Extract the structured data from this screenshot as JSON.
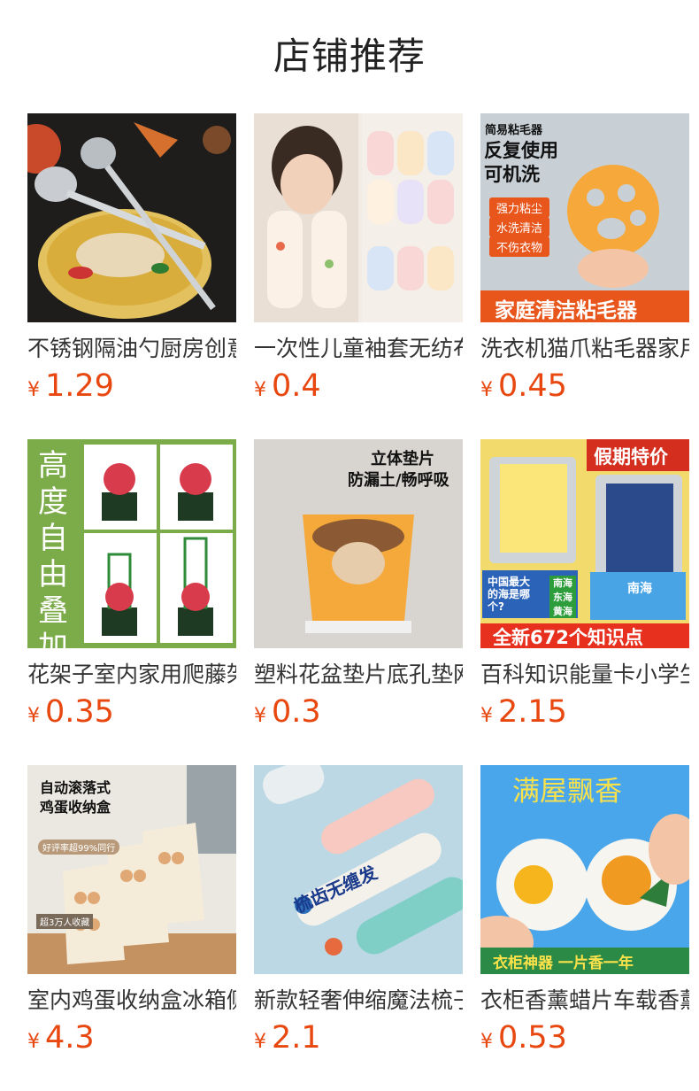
{
  "section_title": "店铺推荐",
  "currency": "¥",
  "products": [
    {
      "name": "不锈钢隔油勺厨房创意",
      "price": "1.29"
    },
    {
      "name": "一次性儿童袖套无纺布",
      "price": "0.4"
    },
    {
      "name": "洗衣机猫爪粘毛器家用",
      "price": "0.45",
      "image_text": {
        "line1": "简易粘毛器",
        "line2": "反复使用",
        "line3": "可机洗",
        "tags": [
          "强力粘尘",
          "水洗清洁",
          "不伤衣物"
        ],
        "banner": "家庭清洁粘毛器"
      }
    },
    {
      "name": "花架子室内家用爬藤架",
      "price": "0.35",
      "image_text": {
        "side": "高度自由叠加"
      }
    },
    {
      "name": "塑料花盆垫片底孔垫网",
      "price": "0.3",
      "image_text": {
        "line1": "立体垫片",
        "line2": "防漏土/畅呼吸"
      }
    },
    {
      "name": "百科知识能量卡小学生",
      "price": "2.15",
      "image_text": {
        "top": "假期特价",
        "card_left": "中国最大的海是哪个?",
        "answers": [
          "南海",
          "东海",
          "黄海"
        ],
        "answer": "南海",
        "banner": "全新672个知识点"
      }
    },
    {
      "name": "室内鸡蛋收纳盒冰箱侧",
      "price": "4.3",
      "image_text": {
        "line1": "自动滚落式",
        "line2": "鸡蛋收纳盒",
        "badge1": "好评率超99%同行",
        "badge2": "超3万人收藏"
      }
    },
    {
      "name": "新款轻奢伸缩魔法梳子",
      "price": "2.1",
      "image_text": {
        "slogan": "梳齿无缠发"
      }
    },
    {
      "name": "衣柜香薰蜡片车载香薰",
      "price": "0.53",
      "image_text": {
        "top": "满屋飘香",
        "bottom": "衣柜神器 一片香一年"
      }
    }
  ]
}
